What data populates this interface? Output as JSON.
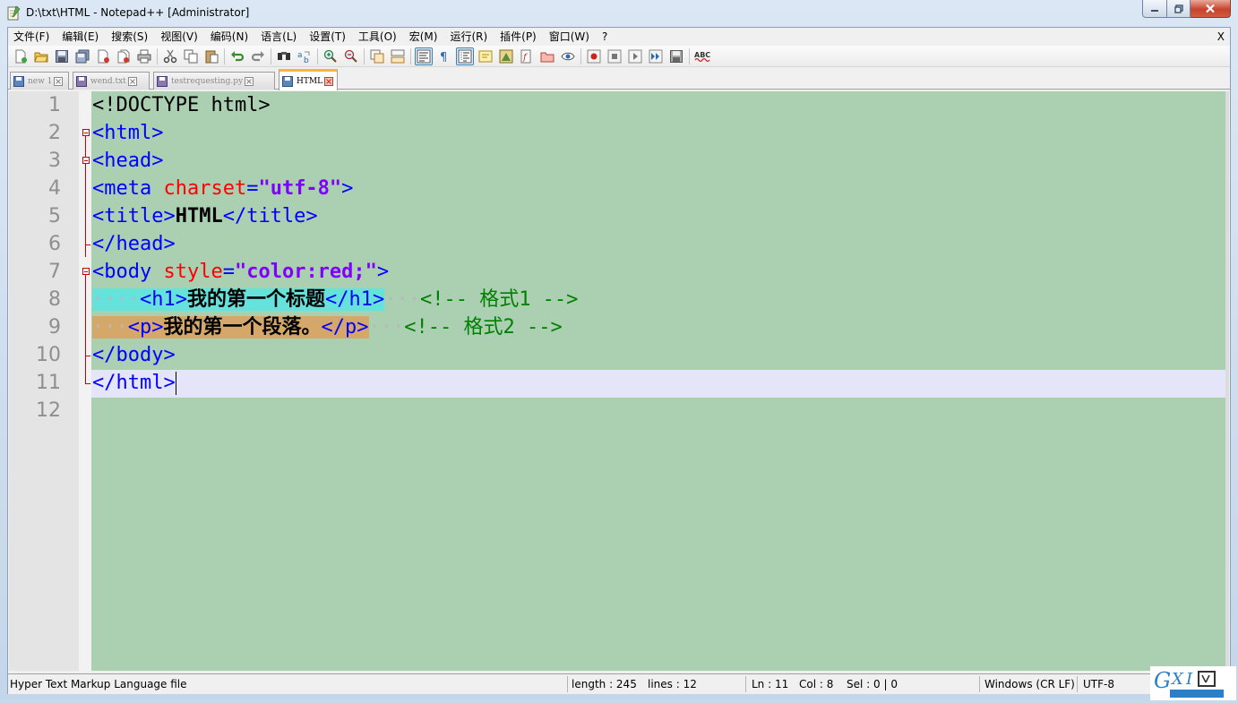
{
  "window": {
    "title": "D:\\txt\\HTML - Notepad++ [Administrator]",
    "app_icon": "notepad-icon"
  },
  "menu": {
    "items": [
      "文件(F)",
      "编辑(E)",
      "搜索(S)",
      "视图(V)",
      "编码(N)",
      "语言(L)",
      "设置(T)",
      "工具(O)",
      "宏(M)",
      "运行(R)",
      "插件(P)",
      "窗口(W)",
      "?"
    ],
    "close_label": "X"
  },
  "toolbar": {
    "icons": [
      "new-file-icon",
      "open-file-icon",
      "save-icon",
      "save-all-icon",
      "close-icon",
      "close-all-icon",
      "print-icon",
      "cut-icon",
      "copy-icon",
      "paste-icon",
      "undo-icon",
      "redo-icon",
      "find-icon",
      "replace-icon",
      "zoom-in-icon",
      "zoom-out-icon",
      "sync-v-icon",
      "sync-h-icon",
      "wrap-icon",
      "show-all-chars-icon",
      "indent-guide-icon",
      "udl-icon",
      "doc-map-icon",
      "function-list-icon",
      "folder-workspace-icon",
      "monitor-icon",
      "record-macro-icon",
      "stop-macro-icon",
      "play-macro-icon",
      "run-macro-icon",
      "save-macro-icon",
      "spellcheck-icon"
    ]
  },
  "tabs": [
    {
      "label": "new 1",
      "active": false
    },
    {
      "label": "wend.txt",
      "active": false
    },
    {
      "label": "testrequesting.py",
      "active": false
    },
    {
      "label": "HTML",
      "active": true
    }
  ],
  "editor": {
    "line_numbers": [
      "1",
      "2",
      "3",
      "4",
      "5",
      "6",
      "7",
      "8",
      "9",
      "10",
      "11",
      "12"
    ],
    "lines": {
      "l1": {
        "doctype": "<!DOCTYPE html>"
      },
      "l2": {
        "tag": "<html>"
      },
      "l3": {
        "tag": "<head>"
      },
      "l4": {
        "tag_open": "<meta ",
        "attr": "charset",
        "eq": "=",
        "value": "\"utf-8\"",
        "tag_close": ">"
      },
      "l5": {
        "tag_open": "<title>",
        "text": "HTML",
        "tag_close": "</title>"
      },
      "l6": {
        "tag": "</head>"
      },
      "l7": {
        "tag_open": "<body ",
        "attr": "style",
        "eq": "=",
        "value": "\"color:red;\"",
        "tag_close": ">"
      },
      "l8": {
        "indent_dots": "····",
        "tag_open": "<h1>",
        "text": "我的第一个标题",
        "tag_close": "</h1>",
        "gap_dots": "···",
        "comment": "<!-- 格式1 -->"
      },
      "l9": {
        "indent_dots": "···",
        "tag_open": "<p>",
        "text": "我的第一个段落。",
        "tag_close": "</p>",
        "gap_dots": "···",
        "comment": "<!-- 格式2 -->"
      },
      "l10": {
        "tag": "</body>"
      },
      "l11": {
        "tag": "</html>"
      }
    }
  },
  "status": {
    "file_type": "Hyper Text Markup Language file",
    "length": "length : 245",
    "lines": "lines : 12",
    "ln": "Ln : 11",
    "col": "Col : 8",
    "sel": "Sel : 0 | 0",
    "eol": "Windows (CR LF)",
    "encoding": "UTF-8"
  },
  "colors": {
    "editor_bg": "#aacfb1",
    "tag": "#0000ff",
    "attribute": "#ff0000",
    "value": "#8000ff",
    "comment": "#008000",
    "highlight_1": "#66e2dc",
    "highlight_2": "#d5a86a",
    "current_line": "#e5e5f9",
    "active_tab_accent": "#fab43c"
  }
}
